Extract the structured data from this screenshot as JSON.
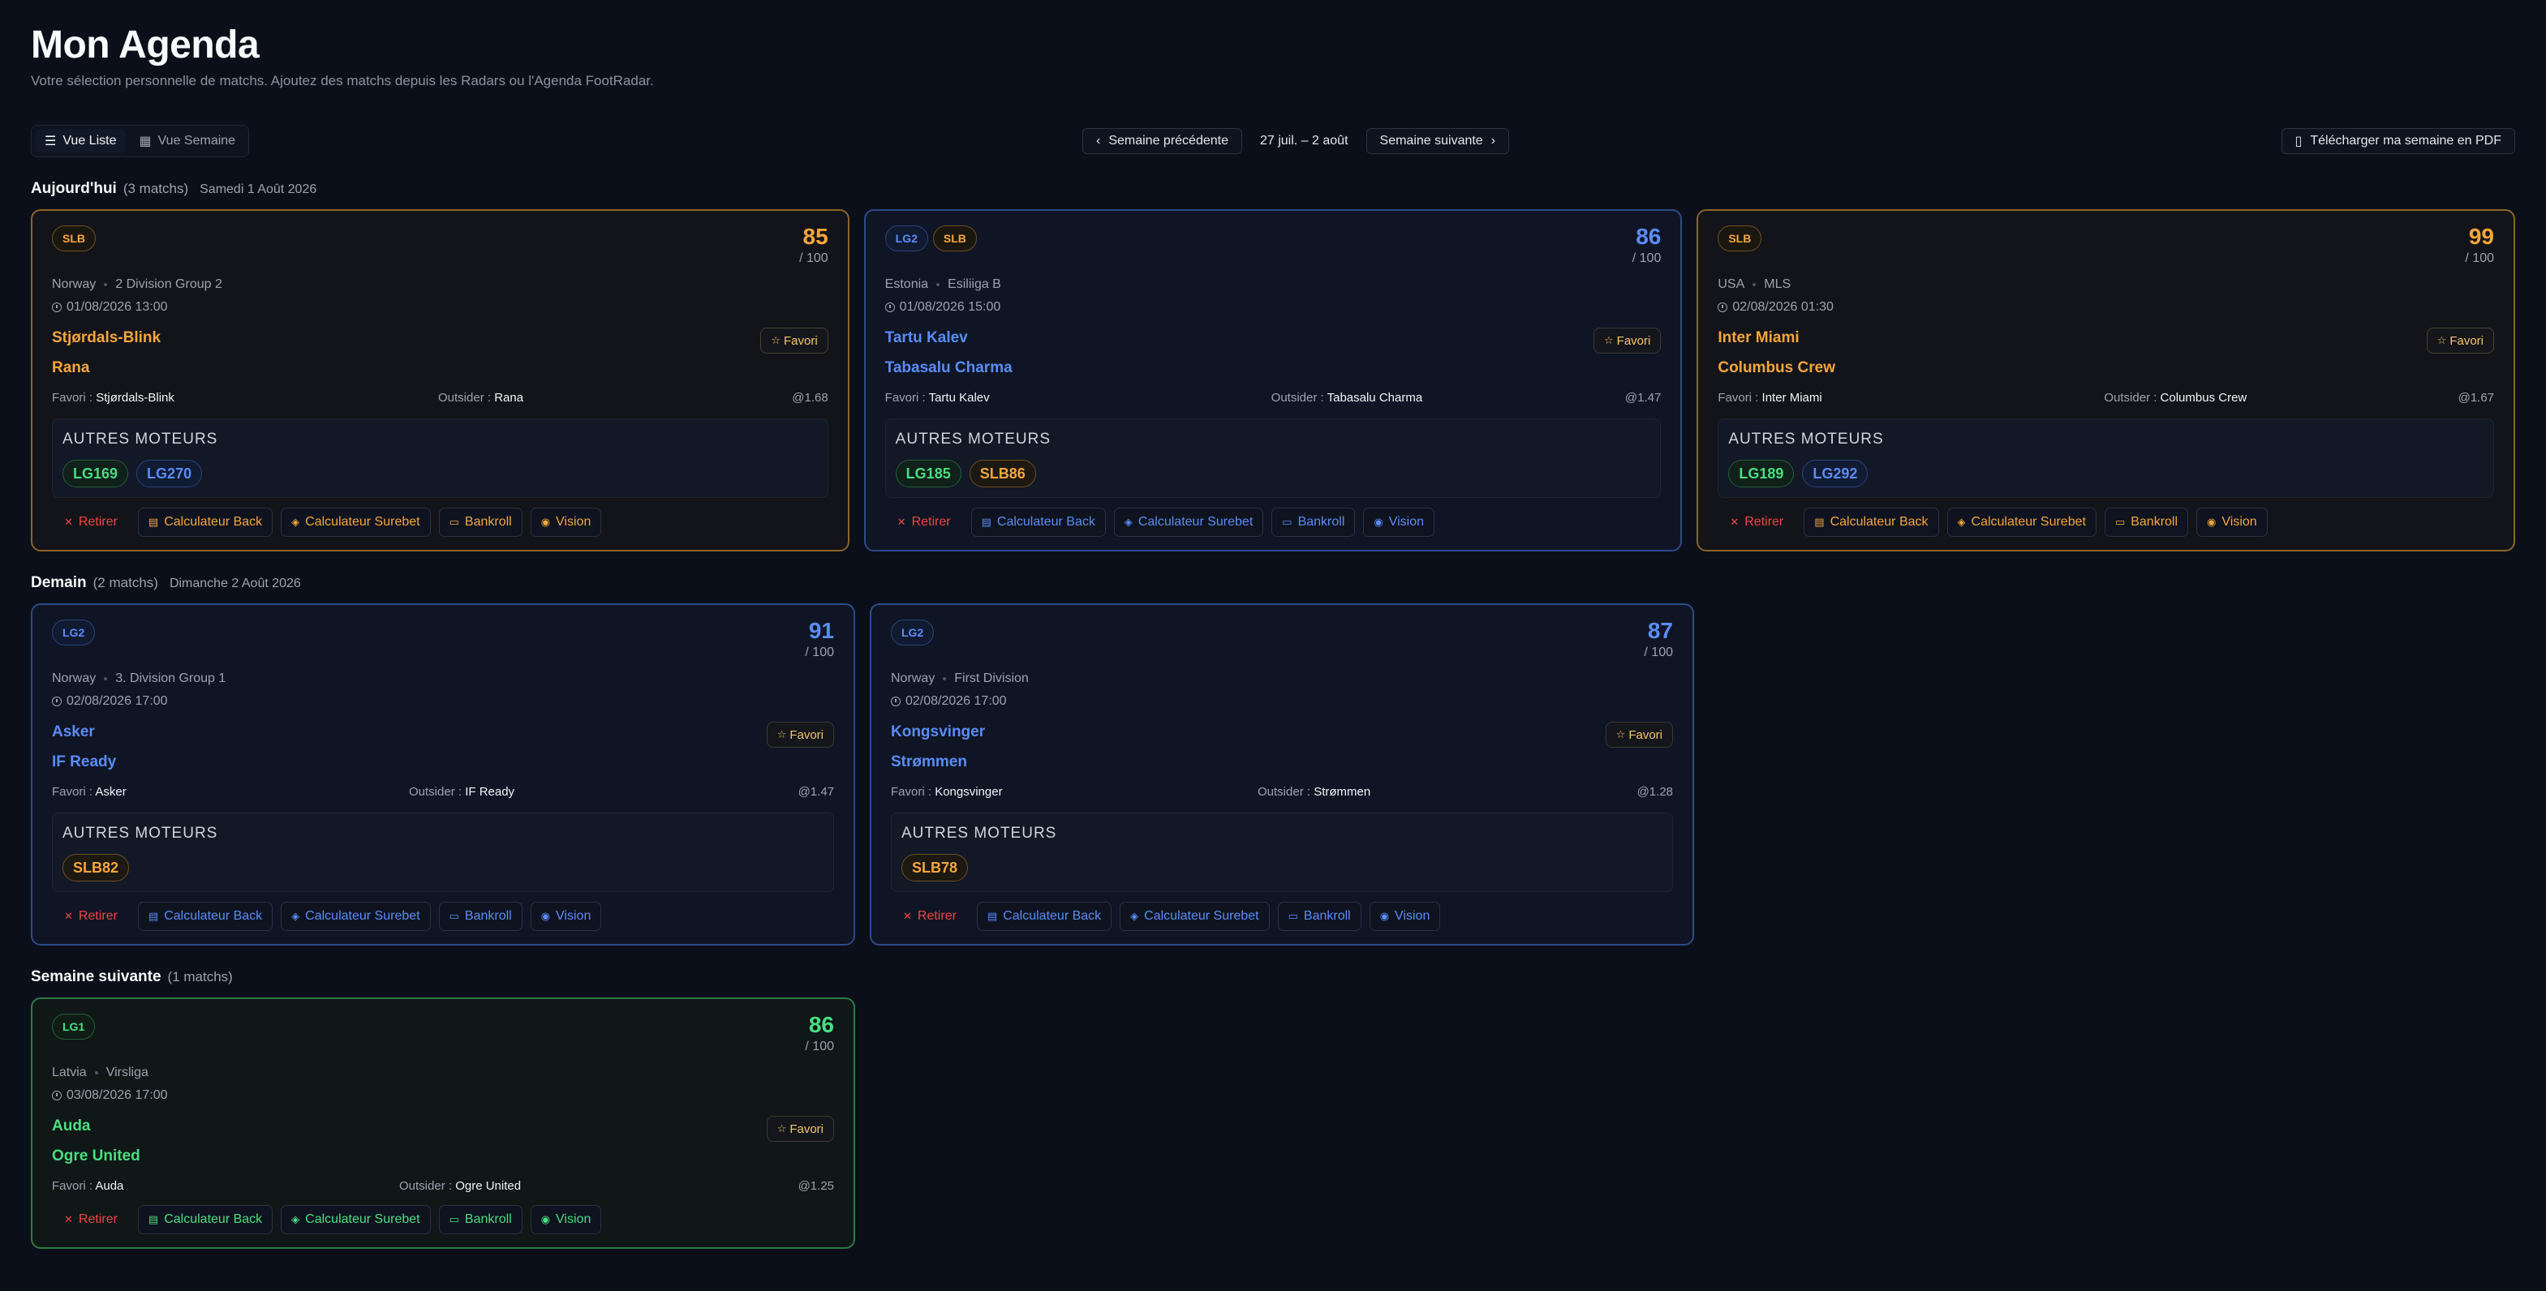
{
  "header": {
    "title": "Mon Agenda",
    "subtitle": "Votre sélection personnelle de matchs. Ajoutez des matchs depuis les Radars ou l'Agenda FootRadar."
  },
  "toolbar": {
    "view_list": "Vue Liste",
    "view_week": "Vue Semaine",
    "prev_week": "Semaine précédente",
    "week_range": "27 juil. – 2 août",
    "next_week": "Semaine suivante",
    "pdf": "Télécharger ma semaine en PDF"
  },
  "labels": {
    "score_den": "/ 100",
    "favori_btn": "Favori",
    "favori_prefix": "Favori :",
    "outsider_prefix": "Outsider :",
    "engines_title": "AUTRES MOTEURS",
    "retire": "Retirer",
    "calc_back": "Calculateur Back",
    "calc_surebet": "Calculateur Surebet",
    "bankroll": "Bankroll",
    "vision": "Vision"
  },
  "sections": [
    {
      "name": "Aujourd'hui",
      "count": "(3 matchs)",
      "date": "Samedi 1 Août 2026",
      "cards": [
        {
          "pills": [
            "SLB"
          ],
          "score": "85",
          "country": "Norway",
          "league": "2 Division Group 2",
          "datetime": "01/08/2026 13:00",
          "team1": "Stjørdals-Blink",
          "team2": "Rana",
          "favori": "Stjørdals-Blink",
          "outsider": "Rana",
          "odd": "@1.68",
          "engines": [
            [
              "LG1",
              "69"
            ],
            [
              "LG2",
              "70"
            ]
          ]
        },
        {
          "pills": [
            "LG2",
            "SLB"
          ],
          "score": "86",
          "country": "Estonia",
          "league": "Esiliiga B",
          "datetime": "01/08/2026 15:00",
          "team1": "Tartu Kalev",
          "team2": "Tabasalu Charma",
          "favori": "Tartu Kalev",
          "outsider": "Tabasalu Charma",
          "odd": "@1.47",
          "engines": [
            [
              "LG1",
              "85"
            ],
            [
              "SLB",
              "86"
            ]
          ]
        },
        {
          "pills": [
            "SLB"
          ],
          "score": "99",
          "country": "USA",
          "league": "MLS",
          "datetime": "02/08/2026 01:30",
          "team1": "Inter Miami",
          "team2": "Columbus Crew",
          "favori": "Inter Miami",
          "outsider": "Columbus Crew",
          "odd": "@1.67",
          "engines": [
            [
              "LG1",
              "89"
            ],
            [
              "LG2",
              "92"
            ]
          ]
        }
      ]
    },
    {
      "name": "Demain",
      "count": "(2 matchs)",
      "date": "Dimanche 2 Août 2026",
      "cards": [
        {
          "pills": [
            "LG2"
          ],
          "score": "91",
          "country": "Norway",
          "league": "3. Division Group 1",
          "datetime": "02/08/2026 17:00",
          "team1": "Asker",
          "team2": "IF Ready",
          "favori": "Asker",
          "outsider": "IF Ready",
          "odd": "@1.47",
          "engines": [
            [
              "SLB",
              "82"
            ]
          ]
        },
        {
          "pills": [
            "LG2"
          ],
          "score": "87",
          "country": "Norway",
          "league": "First Division",
          "datetime": "02/08/2026 17:00",
          "team1": "Kongsvinger",
          "team2": "Strømmen",
          "favori": "Kongsvinger",
          "outsider": "Strømmen",
          "odd": "@1.28",
          "engines": [
            [
              "SLB",
              "78"
            ]
          ]
        }
      ]
    },
    {
      "name": "Semaine suivante",
      "count": "(1 matchs)",
      "date": "",
      "cards": [
        {
          "pills": [
            "LG1"
          ],
          "score": "86",
          "country": "Latvia",
          "league": "Virsliga",
          "datetime": "03/08/2026 17:00",
          "team1": "Auda",
          "team2": "Ogre United",
          "favori": "Auda",
          "outsider": "Ogre United",
          "odd": "@1.25",
          "engines": []
        }
      ]
    }
  ],
  "colors": {
    "SLB": "#f5a63d",
    "LG2": "#5b8cf7",
    "LG1": "#4ade80"
  }
}
